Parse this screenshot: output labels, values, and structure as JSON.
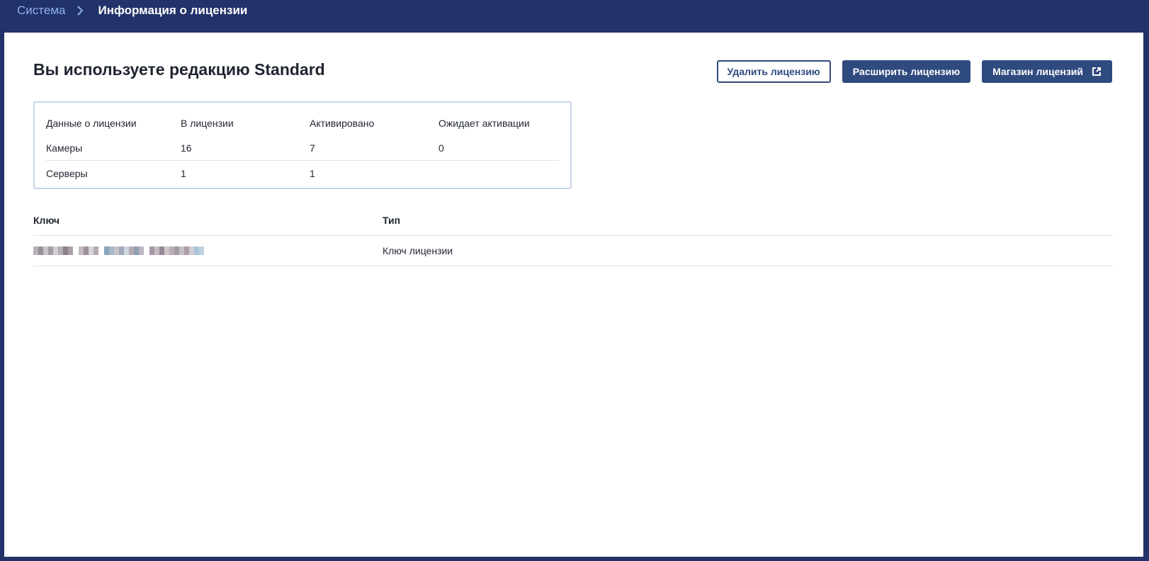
{
  "breadcrumb": {
    "parent": "Система",
    "current": "Информация о лицензии"
  },
  "page": {
    "title": "Вы используете редакцию Standard"
  },
  "actions": {
    "delete_label": "Удалить лицензию",
    "extend_label": "Расширить лицензию",
    "store_label": "Магазин лицензий"
  },
  "license_table": {
    "headers": [
      "Данные о лицензии",
      "В лицензии",
      "Активировано",
      "Ожидает активации"
    ],
    "rows": [
      [
        "Камеры",
        "16",
        "7",
        "0"
      ],
      [
        "Серверы",
        "1",
        "1",
        ""
      ]
    ]
  },
  "keys_table": {
    "headers": [
      "Ключ",
      "Тип"
    ],
    "rows": [
      {
        "type": "Ключ лицензии"
      }
    ]
  },
  "colors": {
    "header_bg": "#22326a",
    "accent": "#2f4a7f",
    "breadcrumb_link": "#8fb0ee"
  },
  "icons": {
    "breadcrumb_separator": "chevron-right-icon",
    "store_button": "external-link-icon"
  }
}
